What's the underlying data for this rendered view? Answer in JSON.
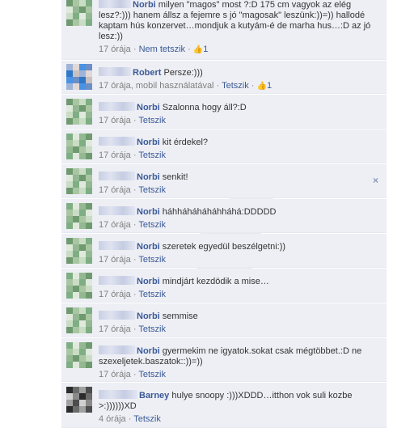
{
  "comments": [
    {
      "author": "Norbi",
      "text": "milyen \"magos\" most ?:D 175 cm vagyok az elég lesz?:))) hanem állsz a fejemre s jó \"magosak\" leszünk:))=)) hallodé kaptam hús konzervet…mondjuk a kutyám-é de marha hus…:D az jó lesz:))",
      "time": "17 órája",
      "action": "Nem tetszik",
      "likes": "1",
      "sep": "·",
      "via": ""
    },
    {
      "author": "Robert",
      "text": "Persze:)))",
      "time": "17 órája",
      "via": "mobil használatával",
      "action": "Tetszik",
      "likes": "1",
      "sep": "·"
    },
    {
      "author": "Norbi",
      "text": "Szalonna hogy áll?:D",
      "time": "17 órája",
      "action": "Tetszik",
      "sep": "·"
    },
    {
      "author": "Norbi",
      "text": "kit érdekel?",
      "time": "17 órája",
      "action": "Tetszik",
      "sep": "·"
    },
    {
      "author": "Norbi",
      "text": "senkit!",
      "time": "17 órája",
      "action": "Tetszik",
      "sep": "·",
      "close": "×"
    },
    {
      "author": "Norbi",
      "text": "háhháháháháhháhá:DDDDD",
      "time": "17 órája",
      "action": "Tetszik",
      "sep": "·"
    },
    {
      "author": "Norbi",
      "text": "szeretek egyedül beszélgetni:))",
      "time": "17 órája",
      "action": "Tetszik",
      "sep": "·"
    },
    {
      "author": "Norbi",
      "text": "mindjárt kezdödik a mise…",
      "time": "17 órája",
      "action": "Tetszik",
      "sep": "·"
    },
    {
      "author": "Norbi",
      "text": "semmise",
      "time": "17 órája",
      "action": "Tetszik",
      "sep": "·"
    },
    {
      "author": "Norbi",
      "text": "gyermekim ne igyatok.sokat csak mégtöbbet.:D ne szexeljetek.baszatok::))=))",
      "time": "17 órája",
      "action": "Tetszik",
      "sep": "·"
    },
    {
      "author": "Barney",
      "text": "hulye snoopy :)))XDDD…itthon vok suli kozbe >:))))))XD",
      "time": "4 órája",
      "action": "Tetszik",
      "sep": "·"
    }
  ],
  "colors": {
    "link": "#3b5998",
    "comment_bg": "#edeff4",
    "meta": "#7f7f7f",
    "avatar_green": [
      "#6f9a6f",
      "#a9c6a2",
      "#c9dcc4",
      "#7fae84",
      "#dfe9dc",
      "#93b892"
    ],
    "avatar_blue": [
      "#6a8fc9",
      "#2f78c8",
      "#c8c0c0",
      "#9fb4d8",
      "#e2d8d8",
      "#4a92e2"
    ],
    "avatar_dark": [
      "#2b2b2b",
      "#6b6b6b",
      "#a0a0a0",
      "#4d4d4d",
      "#d0d0d0",
      "#8a8a8a"
    ]
  },
  "icons": {
    "like": "thumbs-up-icon",
    "close": "close-icon"
  }
}
